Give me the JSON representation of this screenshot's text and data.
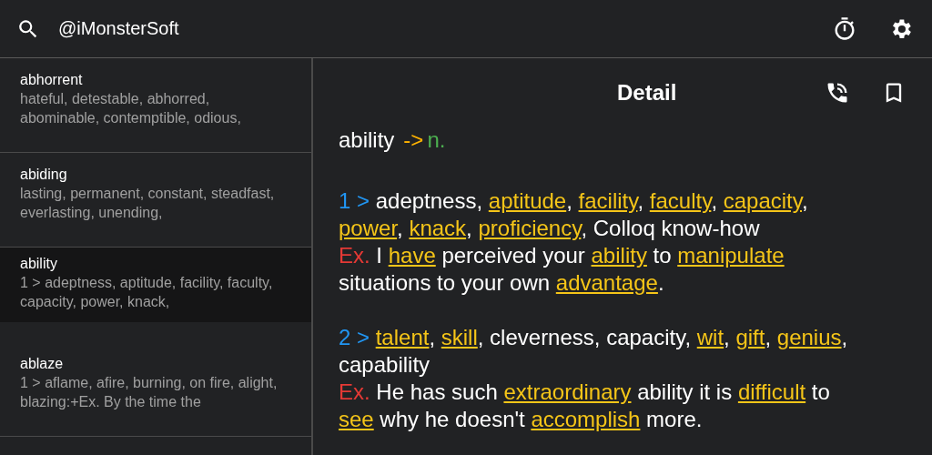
{
  "search": {
    "value": "@iMonsterSoft"
  },
  "words": [
    {
      "word": "abhorrent",
      "preview": "hateful, detestable, abhorred, abominable, contemptible, odious,",
      "selected": false
    },
    {
      "word": "abiding",
      "preview": "lasting, permanent, constant, steadfast, everlasting, unending,",
      "selected": false
    },
    {
      "word": "ability",
      "preview": "1 > adeptness, aptitude, facility, faculty, capacity, power, knack,",
      "selected": true
    },
    {
      "word": "ablaze",
      "preview": "1 > aflame, afire, burning, on fire, alight, blazing:+Ex. By the time the",
      "selected": false
    }
  ],
  "detail": {
    "title": "Detail",
    "headword": "ability",
    "arrow": "->",
    "pos": "n.",
    "senses": [
      {
        "number": "1 >",
        "definition": [
          {
            "text": "adeptness, "
          },
          {
            "text": "aptitude",
            "link": true
          },
          {
            "text": ", "
          },
          {
            "text": "facility",
            "link": true
          },
          {
            "text": ", "
          },
          {
            "text": "faculty",
            "link": true
          },
          {
            "text": ", "
          },
          {
            "text": "capacity",
            "link": true
          },
          {
            "text": ", "
          },
          {
            "text": "power",
            "link": true
          },
          {
            "text": ", "
          },
          {
            "text": "knack",
            "link": true
          },
          {
            "text": ", "
          },
          {
            "text": "proficiency",
            "link": true
          },
          {
            "text": ", Colloq know-how"
          }
        ],
        "ex_label": "Ex.",
        "example": [
          {
            "text": "I "
          },
          {
            "text": "have",
            "link": true
          },
          {
            "text": " perceived your "
          },
          {
            "text": "ability",
            "link": true
          },
          {
            "text": " to "
          },
          {
            "text": "manipulate",
            "link": true
          },
          {
            "text": " situations to your own "
          },
          {
            "text": "advantage",
            "link": true
          },
          {
            "text": "."
          }
        ]
      },
      {
        "number": "2 >",
        "definition": [
          {
            "text": "talent",
            "link": true
          },
          {
            "text": ", "
          },
          {
            "text": "skill",
            "link": true
          },
          {
            "text": ", cleverness, capacity, "
          },
          {
            "text": "wit",
            "link": true
          },
          {
            "text": ", "
          },
          {
            "text": "gift",
            "link": true
          },
          {
            "text": ", "
          },
          {
            "text": "genius",
            "link": true
          },
          {
            "text": ", capability"
          }
        ],
        "ex_label": "Ex.",
        "example": [
          {
            "text": "He has such "
          },
          {
            "text": "extraordinary",
            "link": true
          },
          {
            "text": " ability it is "
          },
          {
            "text": "difficult",
            "link": true
          },
          {
            "text": " to "
          },
          {
            "text": "see",
            "link": true
          },
          {
            "text": " why he doesn't "
          },
          {
            "text": "accomplish",
            "link": true
          },
          {
            "text": " more."
          }
        ]
      }
    ]
  }
}
